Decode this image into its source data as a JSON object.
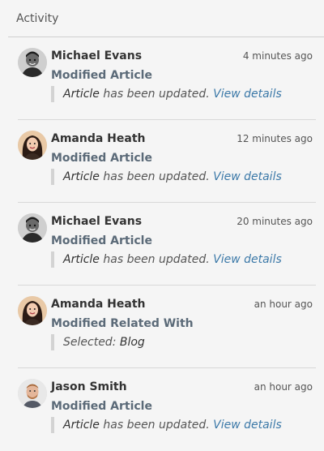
{
  "panel": {
    "title": "Activity"
  },
  "items": [
    {
      "user": "Michael Evans",
      "time": "4 minutes ago",
      "action": "Modified Article",
      "detail": {
        "object": "Article",
        "text": " has been updated. ",
        "link": "View details"
      },
      "avatar": "avatar-michael"
    },
    {
      "user": "Amanda Heath",
      "time": "12 minutes ago",
      "action": "Modified Article",
      "detail": {
        "object": "Article",
        "text": " has been updated. ",
        "link": "View details"
      },
      "avatar": "avatar-amanda"
    },
    {
      "user": "Michael Evans",
      "time": "20 minutes ago",
      "action": "Modified Article",
      "detail": {
        "object": "Article",
        "text": " has been updated. ",
        "link": "View details"
      },
      "avatar": "avatar-michael"
    },
    {
      "user": "Amanda Heath",
      "time": "an hour ago",
      "action": "Modified Related With",
      "detail": {
        "label": "Selected: ",
        "value": "Blog"
      },
      "avatar": "avatar-amanda"
    },
    {
      "user": "Jason Smith",
      "time": "an hour ago",
      "action": "Modified Article",
      "detail": {
        "object": "Article",
        "text": " has been updated. ",
        "link": "View details"
      },
      "avatar": "avatar-jason"
    }
  ],
  "colors": {
    "link": "#3c79a8",
    "action": "#5b6a78",
    "background": "#f5f5f5"
  }
}
